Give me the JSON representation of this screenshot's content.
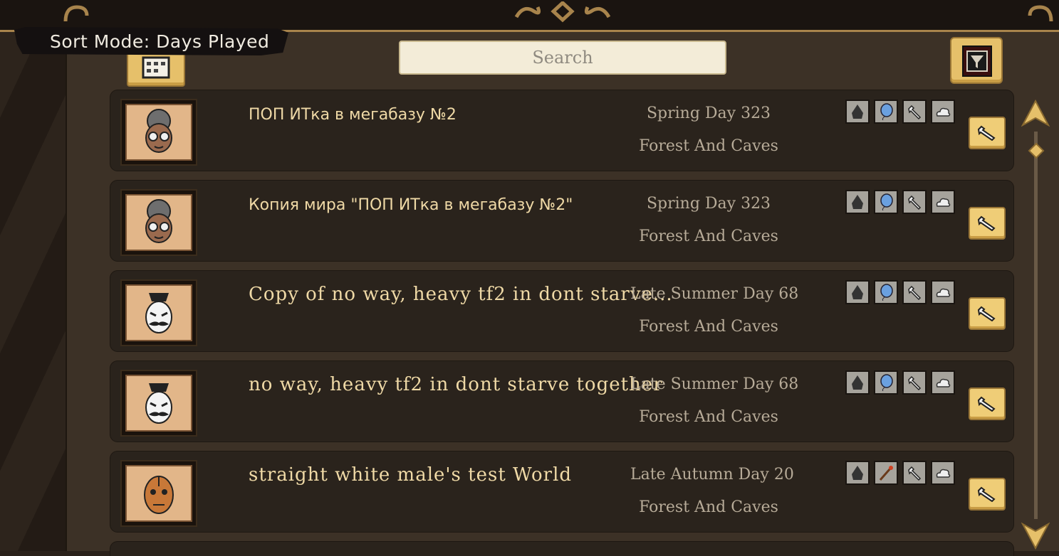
{
  "sort": {
    "label": "Sort Mode: Days Played"
  },
  "search": {
    "placeholder": "Search"
  },
  "icons": {
    "sort": "sort-calendar-icon",
    "filter": "filter-icon",
    "scroll_up": "arrow-up-icon",
    "scroll_down": "arrow-down-icon",
    "manage": "wrench-icon"
  },
  "colors": {
    "accent": "#e6c06a",
    "row_bg": "#2a231c",
    "title_text": "#efd9a6",
    "meta_text": "#b7ab98"
  },
  "worlds": [
    {
      "name": "ПОП ИТка в мегабазу №2",
      "season": "Spring Day 323",
      "location": "Forest And Caves",
      "character": "wickerbottom",
      "mods": [
        "ghost-icon",
        "balloon-icon",
        "wrench-icon",
        "cloud-icon"
      ]
    },
    {
      "name": "Копия мира \"ПОП ИТка в мегабазу №2\"",
      "season": "Spring Day 323",
      "location": "Forest And Caves",
      "character": "wickerbottom",
      "mods": [
        "ghost-icon",
        "balloon-icon",
        "wrench-icon",
        "cloud-icon"
      ]
    },
    {
      "name": "Copy of no way, heavy tf2 in dont starve...",
      "season": "Late Summer Day 68",
      "location": "Forest And Caves",
      "character": "maxwell",
      "mods": [
        "ghost-icon",
        "balloon-icon",
        "wrench-icon",
        "cloud-icon"
      ]
    },
    {
      "name": "no way, heavy tf2 in dont starve together",
      "season": "Late Summer Day 68",
      "location": "Forest And Caves",
      "character": "maxwell",
      "mods": [
        "ghost-icon",
        "balloon-icon",
        "wrench-icon",
        "cloud-icon"
      ]
    },
    {
      "name": "straight white male's test World",
      "season": "Late Autumn Day 20",
      "location": "Forest And Caves",
      "character": "wx78",
      "mods": [
        "ghost-icon",
        "staff-icon",
        "wrench-icon",
        "cloud-icon"
      ]
    }
  ]
}
